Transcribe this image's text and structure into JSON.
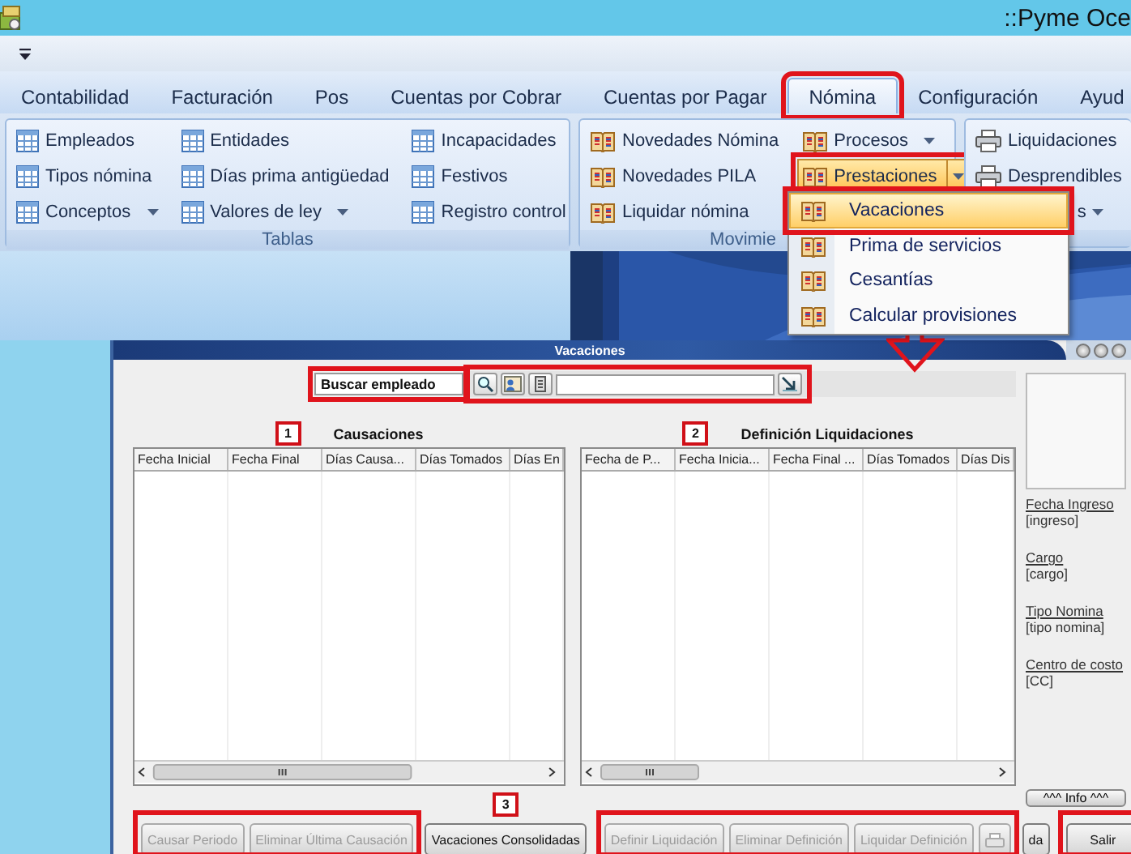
{
  "window": {
    "title": "::Pyme Oce"
  },
  "tabs": [
    {
      "label": "Contabilidad",
      "selected": false,
      "highlighted": false
    },
    {
      "label": "Facturación",
      "selected": false,
      "highlighted": false
    },
    {
      "label": "Pos",
      "selected": false,
      "highlighted": false
    },
    {
      "label": "Cuentas por Cobrar",
      "selected": false,
      "highlighted": false
    },
    {
      "label": "Cuentas por Pagar",
      "selected": false,
      "highlighted": false
    },
    {
      "label": "Nómina",
      "selected": true,
      "highlighted": true
    },
    {
      "label": "Configuración",
      "selected": false,
      "highlighted": false
    },
    {
      "label": "Ayud",
      "selected": false,
      "highlighted": false
    }
  ],
  "ribbon_groups": [
    {
      "label": "Tablas",
      "label_clipped": false,
      "columns": [
        [
          {
            "label": "Empleados",
            "kind": "table",
            "dropdown": false,
            "pressed": false,
            "highlighted": false
          },
          {
            "label": "Tipos nómina",
            "kind": "table",
            "dropdown": false,
            "pressed": false,
            "highlighted": false
          },
          {
            "label": "Conceptos",
            "kind": "table",
            "dropdown": true,
            "pressed": false,
            "highlighted": false
          }
        ],
        [
          {
            "label": "Entidades",
            "kind": "table",
            "dropdown": false,
            "pressed": false,
            "highlighted": false
          },
          {
            "label": "Días prima antigüedad",
            "kind": "table",
            "dropdown": false,
            "pressed": false,
            "highlighted": false
          },
          {
            "label": "Valores de ley",
            "kind": "table",
            "dropdown": true,
            "pressed": false,
            "highlighted": false
          }
        ],
        [
          {
            "label": "Incapacidades",
            "kind": "table",
            "dropdown": false,
            "pressed": false,
            "highlighted": false
          },
          {
            "label": "Festivos",
            "kind": "table",
            "dropdown": false,
            "pressed": false,
            "highlighted": false
          },
          {
            "label": "Registro control",
            "kind": "table",
            "dropdown": false,
            "pressed": false,
            "highlighted": false
          }
        ]
      ]
    },
    {
      "label": "Movimie",
      "label_clipped": true,
      "columns": [
        [
          {
            "label": "Novedades Nómina",
            "kind": "book",
            "dropdown": false,
            "pressed": false,
            "highlighted": false
          },
          {
            "label": "Novedades PILA",
            "kind": "book",
            "dropdown": false,
            "pressed": false,
            "highlighted": false
          },
          {
            "label": "Liquidar nómina",
            "kind": "book",
            "dropdown": false,
            "pressed": false,
            "highlighted": false
          }
        ],
        [
          {
            "label": "Procesos",
            "kind": "book",
            "dropdown": true,
            "pressed": false,
            "highlighted": false
          },
          {
            "label": "Prestaciones",
            "kind": "book",
            "dropdown": true,
            "pressed": true,
            "highlighted": true
          }
        ]
      ]
    },
    {
      "columns": [
        [
          {
            "label": "Liquidaciones",
            "kind": "printer",
            "dropdown": false,
            "pressed": false,
            "highlighted": false
          },
          {
            "label": "Desprendibles",
            "kind": "printer",
            "dropdown": false,
            "pressed": false,
            "highlighted": false
          }
        ]
      ],
      "tail": {
        "label": "s",
        "dropdown": true
      }
    }
  ],
  "menu": {
    "items": [
      {
        "label": "Vacaciones",
        "selected": true,
        "highlighted": true
      },
      {
        "label": "Prima de servicios",
        "selected": false,
        "highlighted": false
      },
      {
        "label": "Cesantías",
        "selected": false,
        "highlighted": false
      },
      {
        "label": "Calcular provisiones",
        "selected": false,
        "highlighted": false
      }
    ]
  },
  "callout_arrow": true,
  "dialog": {
    "title": "Vacaciones",
    "search": {
      "label": "Buscar empleado",
      "highlighted": true,
      "toolbar_highlighted": true
    },
    "tables": [
      {
        "marker": "1",
        "title": "Causaciones",
        "columns": [
          "Fecha Inicial",
          "Fecha Final",
          "Días Causa...",
          "Días Tomados",
          "Días En"
        ]
      },
      {
        "marker": "2",
        "title": "Definición Liquidaciones",
        "columns": [
          "Fecha de P...",
          "Fecha Inicia...",
          "Fecha Final ...",
          "Días Tomados",
          "Días Dis"
        ]
      }
    ],
    "employee_info": {
      "fields": [
        {
          "label": "Fecha Ingreso",
          "value": "[ingreso]"
        },
        {
          "label": "Cargo",
          "value": "[cargo]"
        },
        {
          "label": "Tipo Nomina",
          "value": "[tipo nomina]"
        },
        {
          "label": "Centro de costo",
          "value": "[CC]"
        }
      ],
      "info_button": "^^^ Info ^^^"
    },
    "button_groups": [
      {
        "highlighted": true,
        "buttons": [
          {
            "kind": "text",
            "label": "Causar Periodo",
            "disabled": true
          },
          {
            "kind": "text",
            "label": "Eliminar Última Causación",
            "disabled": true
          }
        ]
      },
      {
        "highlighted": false,
        "marker": "3",
        "buttons": [
          {
            "kind": "text",
            "label": "Vacaciones Consolidadas",
            "disabled": false
          }
        ]
      },
      {
        "highlighted": true,
        "buttons": [
          {
            "kind": "text",
            "label": "Definir Liquidación",
            "disabled": true
          },
          {
            "kind": "text",
            "label": "Eliminar Definición",
            "disabled": true
          },
          {
            "kind": "text",
            "label": "Liquidar Definición",
            "disabled": true
          },
          {
            "kind": "print",
            "disabled": true
          }
        ]
      },
      {
        "highlighted": false,
        "buttons": [
          {
            "kind": "text",
            "label": "da",
            "disabled": false
          }
        ]
      },
      {
        "highlighted": true,
        "buttons": [
          {
            "kind": "text",
            "label": "Salir",
            "disabled": false
          }
        ]
      }
    ]
  }
}
